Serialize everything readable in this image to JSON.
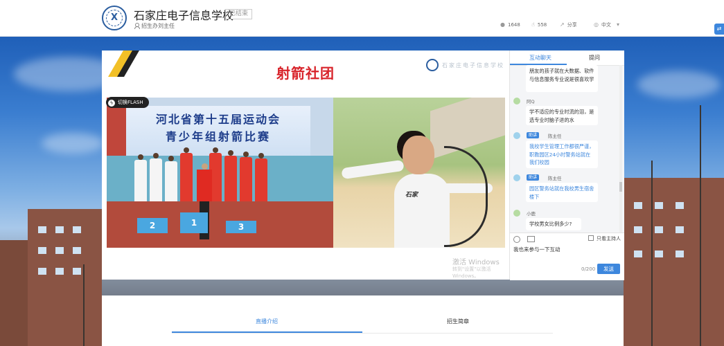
{
  "header": {
    "school_name": "石家庄电子信息学校",
    "status_badge": "已结束",
    "host": "招生办刘主任",
    "views": "1648",
    "likes": "558",
    "share_label": "分享",
    "language": "中文",
    "icons": [
      "person-icon",
      "eye-icon",
      "thumbs-up-icon",
      "share-icon",
      "globe-icon",
      "chevron-down-icon"
    ]
  },
  "player": {
    "banner_title": "射箭社团",
    "switch_flash_label": "切换FLASH",
    "scene_board_line1": "河北省第十五届运动会",
    "scene_board_line2": "青少年组射箭比赛",
    "podium_numbers": [
      "2",
      "1",
      "3"
    ],
    "shirt_text": "石家",
    "watermark_title": "激活 Windows",
    "watermark_sub": "转到\"设置\"以激活 Windows。"
  },
  "chat": {
    "tabs": [
      "互动聊天",
      "提问"
    ],
    "active_tab": 0,
    "messages": [
      {
        "user": "",
        "role": "visitor",
        "text": "朋友的孩子就在大数据、软件与信息服务专业说是很喜欢学"
      },
      {
        "user": "阿Q",
        "role": "visitor",
        "text": "学不适应的专业时流的泪，是选专业时脑子进的水"
      },
      {
        "user": "陈主任",
        "tag": "助讲",
        "role": "teacher",
        "text": "我校学生管理工作都很严谨，职教园区24小时警务站就在我们校园"
      },
      {
        "user": "陈主任",
        "tag": "助讲",
        "role": "teacher",
        "text": "园区警务站就在我校男生宿舍楼下"
      },
      {
        "user": "小鹿",
        "role": "visitor",
        "text": "学校男女比例多少?"
      }
    ],
    "only_host_label": "只看主持人",
    "input_value": "我也来参与一下互动",
    "counter": "0/200",
    "send_label": "发送"
  },
  "content": {
    "tabs": [
      "直播介绍",
      "招生简章"
    ],
    "active_tab": 0
  },
  "colors": {
    "accent": "#3d87dd",
    "banner_title": "#d8232a",
    "stripe_yellow": "#f2c027"
  }
}
